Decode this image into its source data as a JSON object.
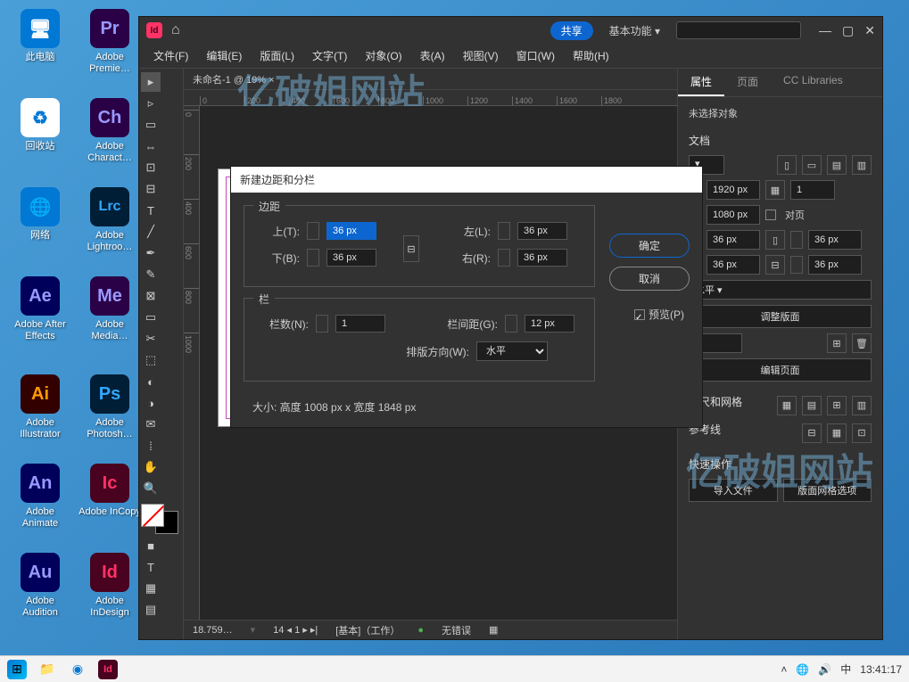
{
  "desktop": {
    "icons": [
      {
        "label": "此电脑",
        "color": "#0078d4",
        "glyph": "🖥"
      },
      {
        "label": "回收站",
        "color": "#333",
        "glyph": "🗑"
      },
      {
        "label": "网络",
        "color": "#0078d4",
        "glyph": "🌐"
      },
      {
        "label": "Adobe After Effects",
        "color": "#00005b",
        "glyph": "Ae"
      },
      {
        "label": "Adobe Illustrator",
        "color": "#330000",
        "glyph": "Ai"
      },
      {
        "label": "Adobe Animate",
        "color": "#00005b",
        "glyph": "An"
      },
      {
        "label": "Adobe Audition",
        "color": "#00005b",
        "glyph": "Au"
      },
      {
        "label": "Adobe Premie…",
        "color": "#2a0046",
        "glyph": "Pr"
      },
      {
        "label": "Adobe Charact…",
        "color": "#2a0046",
        "glyph": "Ch"
      },
      {
        "label": "Adobe Lightroo…",
        "color": "#001e36",
        "glyph": "Lrc"
      },
      {
        "label": "Adobe Media…",
        "color": "#2a0046",
        "glyph": "Me"
      },
      {
        "label": "Adobe Photosh…",
        "color": "#001e36",
        "glyph": "Ps"
      },
      {
        "label": "Adobe InCopy",
        "color": "#49021f",
        "glyph": "Ic"
      },
      {
        "label": "Adobe InDesign",
        "color": "#49021f",
        "glyph": "Id"
      }
    ]
  },
  "titlebar": {
    "app_glyph": "Id",
    "share": "共享",
    "workspace": "基本功能"
  },
  "menu": {
    "items": [
      "文件(F)",
      "编辑(E)",
      "版面(L)",
      "文字(T)",
      "对象(O)",
      "表(A)",
      "视图(V)",
      "窗口(W)",
      "帮助(H)"
    ]
  },
  "doc_tab": "未命名-1 @ 19% ×",
  "ruler_marks": [
    "0",
    "200",
    "400",
    "600",
    "800",
    "1000",
    "1200",
    "1400",
    "1600",
    "1800"
  ],
  "ruler_v_marks": [
    "0",
    "200",
    "400",
    "600",
    "800",
    "1000"
  ],
  "statusbar": {
    "zoom": "18.759…",
    "layout": "[基本]（工作）",
    "errors": "无错误",
    "page": "1"
  },
  "panels": {
    "tabs": [
      "属性",
      "页面",
      "CC Libraries"
    ],
    "no_selection": "未选择对象",
    "doc_section": "文档",
    "w_value": "1920 px",
    "h_value": "1080 px",
    "facing": "对页",
    "margin_value": "36 px",
    "units_value": "1",
    "layout_dir": "水平",
    "adjust_btn": "调整版面",
    "edit_page_btn": "编辑页面",
    "ruler_grid": "标尺和网格",
    "guides": "参考线",
    "quick_actions": "快速操作",
    "import_btn": "导入文件",
    "grid_options_btn": "版面网格选项"
  },
  "dialog": {
    "title": "新建边距和分栏",
    "margins_legend": "边距",
    "top_label": "上(T):",
    "bottom_label": "下(B):",
    "left_label": "左(L):",
    "right_label": "右(R):",
    "margin_val": "36 px",
    "columns_legend": "栏",
    "col_count_label": "栏数(N):",
    "col_count": "1",
    "gutter_label": "栏间距(G):",
    "gutter": "12 px",
    "direction_label": "排版方向(W):",
    "direction": "水平",
    "ok": "确定",
    "cancel": "取消",
    "preview": "预览(P)",
    "size_info": "大小:  高度 1008 px x 宽度 1848 px"
  },
  "taskbar": {
    "time": "13:41:17",
    "ime": "中"
  },
  "watermark": "亿破姐网站"
}
